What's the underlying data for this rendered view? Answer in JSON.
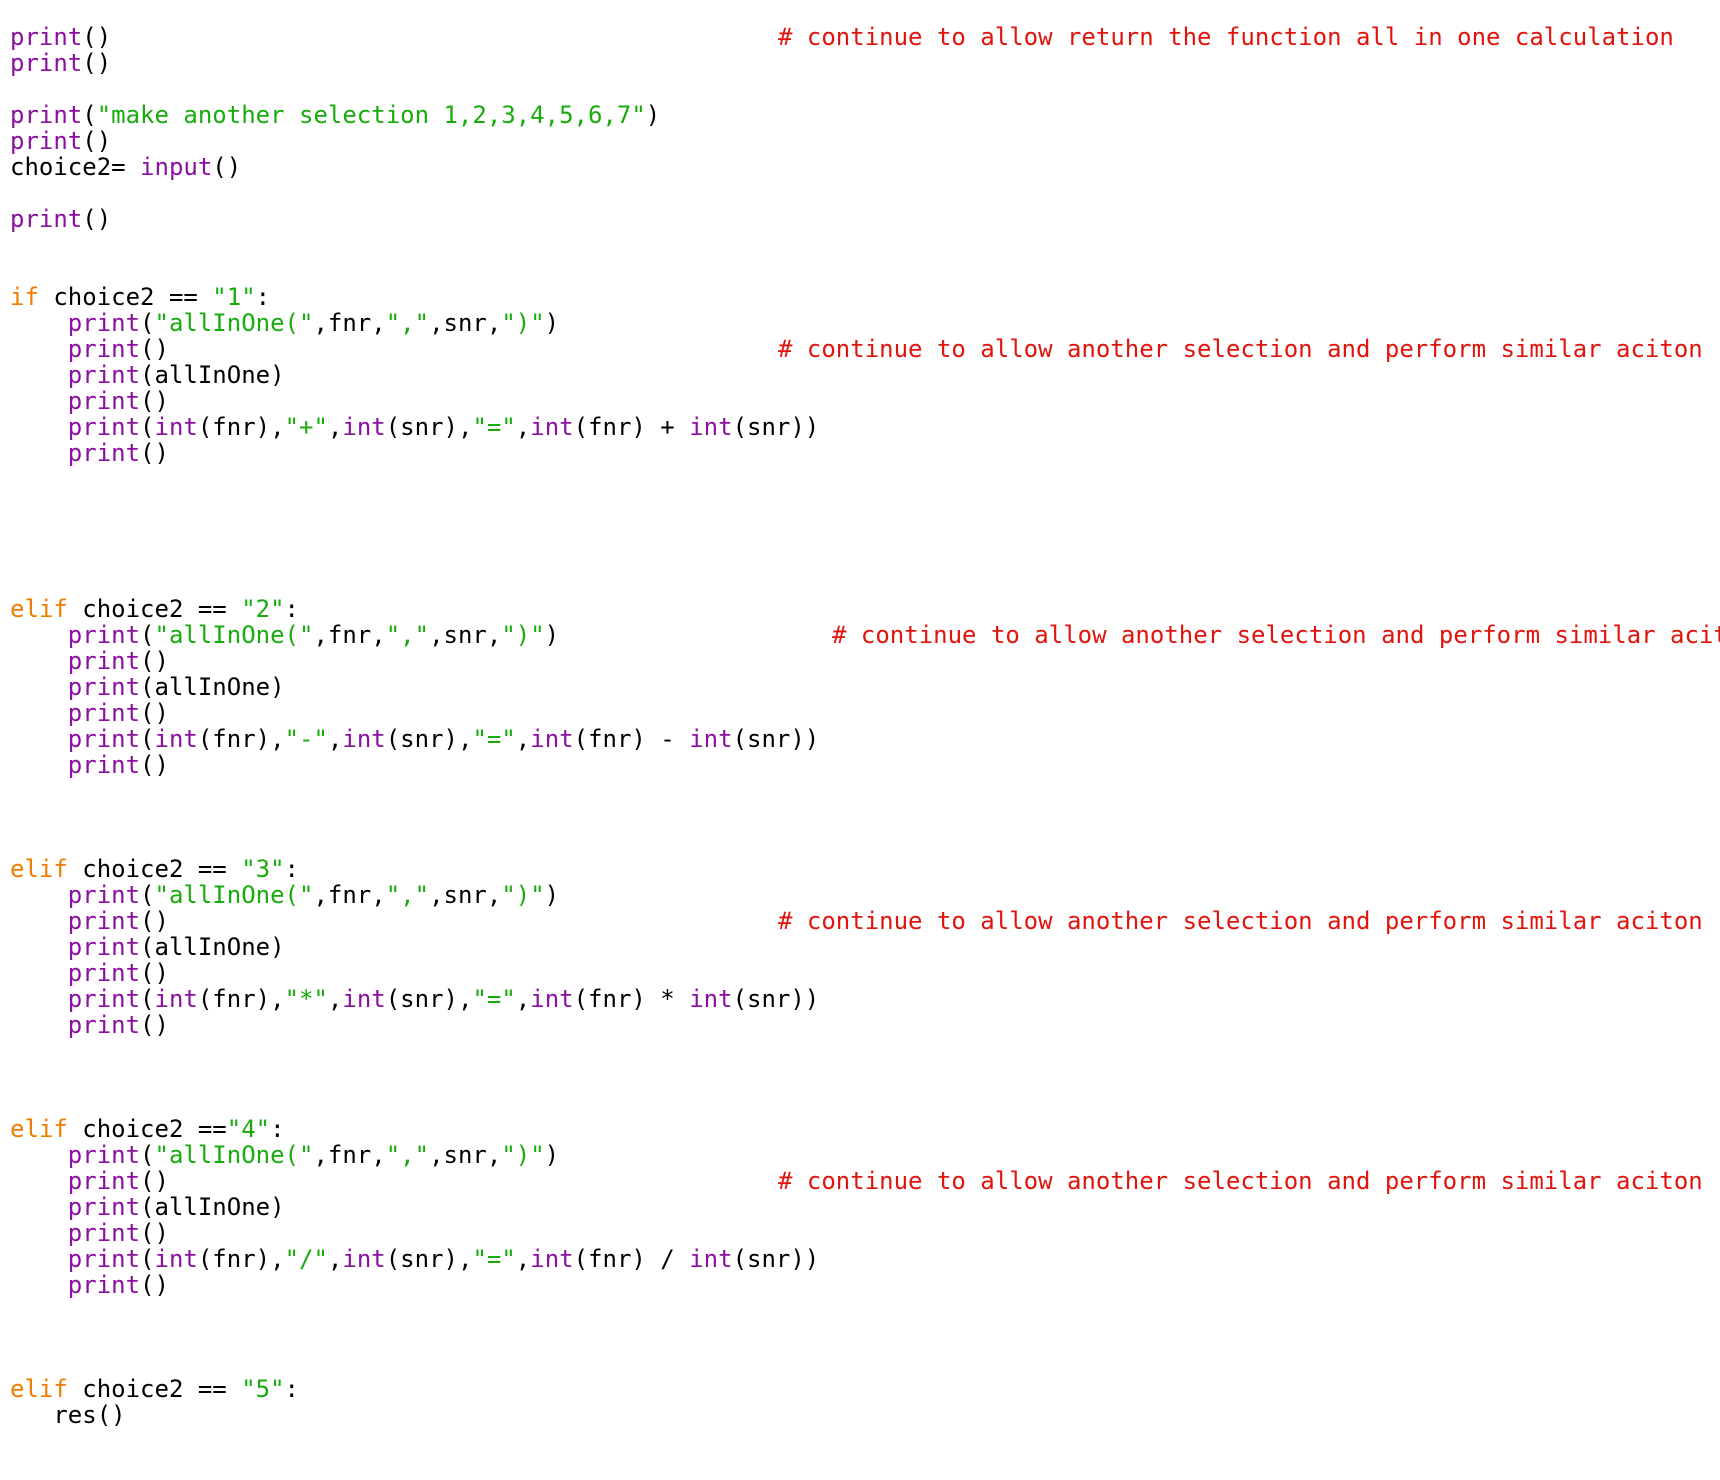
{
  "colors": {
    "function": "#8b0fa0",
    "keyword": "#f07c00",
    "string": "#18ab0c",
    "comment": "#e0140c",
    "plain": "#000000"
  },
  "lines": [
    {
      "tokens": [
        {
          "t": "fn",
          "v": "print"
        },
        {
          "t": "pl",
          "v": "()"
        }
      ],
      "comment": "# continue to allow return the function all in one calculation",
      "cpos": "c1"
    },
    {
      "tokens": [
        {
          "t": "fn",
          "v": "print"
        },
        {
          "t": "pl",
          "v": "()"
        }
      ]
    },
    {
      "tokens": []
    },
    {
      "tokens": [
        {
          "t": "fn",
          "v": "print"
        },
        {
          "t": "pl",
          "v": "("
        },
        {
          "t": "st",
          "v": "\"make another selection 1,2,3,4,5,6,7\""
        },
        {
          "t": "pl",
          "v": ")"
        }
      ]
    },
    {
      "tokens": [
        {
          "t": "fn",
          "v": "print"
        },
        {
          "t": "pl",
          "v": "()"
        }
      ]
    },
    {
      "tokens": [
        {
          "t": "pl",
          "v": "choice2= "
        },
        {
          "t": "fn",
          "v": "input"
        },
        {
          "t": "pl",
          "v": "()"
        }
      ]
    },
    {
      "tokens": []
    },
    {
      "tokens": [
        {
          "t": "fn",
          "v": "print"
        },
        {
          "t": "pl",
          "v": "()"
        }
      ]
    },
    {
      "tokens": []
    },
    {
      "tokens": []
    },
    {
      "tokens": [
        {
          "t": "kw",
          "v": "if"
        },
        {
          "t": "pl",
          "v": " choice2 == "
        },
        {
          "t": "st",
          "v": "\"1\""
        },
        {
          "t": "pl",
          "v": ":"
        }
      ]
    },
    {
      "tokens": [
        {
          "t": "pl",
          "v": "    "
        },
        {
          "t": "fn",
          "v": "print"
        },
        {
          "t": "pl",
          "v": "("
        },
        {
          "t": "st",
          "v": "\"allInOne(\""
        },
        {
          "t": "pl",
          "v": ",fnr,"
        },
        {
          "t": "st",
          "v": "\",\""
        },
        {
          "t": "pl",
          "v": ",snr,"
        },
        {
          "t": "st",
          "v": "\")\""
        },
        {
          "t": "pl",
          "v": ")"
        }
      ]
    },
    {
      "tokens": [
        {
          "t": "pl",
          "v": "    "
        },
        {
          "t": "fn",
          "v": "print"
        },
        {
          "t": "pl",
          "v": "()"
        }
      ],
      "comment": "# continue to allow another selection and perform similar aciton",
      "cpos": "c1"
    },
    {
      "tokens": [
        {
          "t": "pl",
          "v": "    "
        },
        {
          "t": "fn",
          "v": "print"
        },
        {
          "t": "pl",
          "v": "(allInOne)"
        }
      ]
    },
    {
      "tokens": [
        {
          "t": "pl",
          "v": "    "
        },
        {
          "t": "fn",
          "v": "print"
        },
        {
          "t": "pl",
          "v": "()"
        }
      ]
    },
    {
      "tokens": [
        {
          "t": "pl",
          "v": "    "
        },
        {
          "t": "fn",
          "v": "print"
        },
        {
          "t": "pl",
          "v": "("
        },
        {
          "t": "fn",
          "v": "int"
        },
        {
          "t": "pl",
          "v": "(fnr),"
        },
        {
          "t": "st",
          "v": "\"+\""
        },
        {
          "t": "pl",
          "v": ","
        },
        {
          "t": "fn",
          "v": "int"
        },
        {
          "t": "pl",
          "v": "(snr),"
        },
        {
          "t": "st",
          "v": "\"=\""
        },
        {
          "t": "pl",
          "v": ","
        },
        {
          "t": "fn",
          "v": "int"
        },
        {
          "t": "pl",
          "v": "(fnr) + "
        },
        {
          "t": "fn",
          "v": "int"
        },
        {
          "t": "pl",
          "v": "(snr))"
        }
      ]
    },
    {
      "tokens": [
        {
          "t": "pl",
          "v": "    "
        },
        {
          "t": "fn",
          "v": "print"
        },
        {
          "t": "pl",
          "v": "()"
        }
      ]
    },
    {
      "tokens": []
    },
    {
      "tokens": []
    },
    {
      "tokens": []
    },
    {
      "tokens": []
    },
    {
      "tokens": []
    },
    {
      "tokens": [
        {
          "t": "kw",
          "v": "elif"
        },
        {
          "t": "pl",
          "v": " choice2 == "
        },
        {
          "t": "st",
          "v": "\"2\""
        },
        {
          "t": "pl",
          "v": ":"
        }
      ]
    },
    {
      "tokens": [
        {
          "t": "pl",
          "v": "    "
        },
        {
          "t": "fn",
          "v": "print"
        },
        {
          "t": "pl",
          "v": "("
        },
        {
          "t": "st",
          "v": "\"allInOne(\""
        },
        {
          "t": "pl",
          "v": ",fnr,"
        },
        {
          "t": "st",
          "v": "\",\""
        },
        {
          "t": "pl",
          "v": ",snr,"
        },
        {
          "t": "st",
          "v": "\")\""
        },
        {
          "t": "pl",
          "v": ")"
        }
      ],
      "comment": "# continue to allow another selection and perform similar aciton",
      "cpos": "c2"
    },
    {
      "tokens": [
        {
          "t": "pl",
          "v": "    "
        },
        {
          "t": "fn",
          "v": "print"
        },
        {
          "t": "pl",
          "v": "()"
        }
      ]
    },
    {
      "tokens": [
        {
          "t": "pl",
          "v": "    "
        },
        {
          "t": "fn",
          "v": "print"
        },
        {
          "t": "pl",
          "v": "(allInOne)"
        }
      ]
    },
    {
      "tokens": [
        {
          "t": "pl",
          "v": "    "
        },
        {
          "t": "fn",
          "v": "print"
        },
        {
          "t": "pl",
          "v": "()"
        }
      ]
    },
    {
      "tokens": [
        {
          "t": "pl",
          "v": "    "
        },
        {
          "t": "fn",
          "v": "print"
        },
        {
          "t": "pl",
          "v": "("
        },
        {
          "t": "fn",
          "v": "int"
        },
        {
          "t": "pl",
          "v": "(fnr),"
        },
        {
          "t": "st",
          "v": "\"-\""
        },
        {
          "t": "pl",
          "v": ","
        },
        {
          "t": "fn",
          "v": "int"
        },
        {
          "t": "pl",
          "v": "(snr),"
        },
        {
          "t": "st",
          "v": "\"=\""
        },
        {
          "t": "pl",
          "v": ","
        },
        {
          "t": "fn",
          "v": "int"
        },
        {
          "t": "pl",
          "v": "(fnr) - "
        },
        {
          "t": "fn",
          "v": "int"
        },
        {
          "t": "pl",
          "v": "(snr))"
        }
      ]
    },
    {
      "tokens": [
        {
          "t": "pl",
          "v": "    "
        },
        {
          "t": "fn",
          "v": "print"
        },
        {
          "t": "pl",
          "v": "()"
        }
      ]
    },
    {
      "tokens": []
    },
    {
      "tokens": []
    },
    {
      "tokens": []
    },
    {
      "tokens": [
        {
          "t": "kw",
          "v": "elif"
        },
        {
          "t": "pl",
          "v": " choice2 == "
        },
        {
          "t": "st",
          "v": "\"3\""
        },
        {
          "t": "pl",
          "v": ":"
        }
      ]
    },
    {
      "tokens": [
        {
          "t": "pl",
          "v": "    "
        },
        {
          "t": "fn",
          "v": "print"
        },
        {
          "t": "pl",
          "v": "("
        },
        {
          "t": "st",
          "v": "\"allInOne(\""
        },
        {
          "t": "pl",
          "v": ",fnr,"
        },
        {
          "t": "st",
          "v": "\",\""
        },
        {
          "t": "pl",
          "v": ",snr,"
        },
        {
          "t": "st",
          "v": "\")\""
        },
        {
          "t": "pl",
          "v": ")"
        }
      ]
    },
    {
      "tokens": [
        {
          "t": "pl",
          "v": "    "
        },
        {
          "t": "fn",
          "v": "print"
        },
        {
          "t": "pl",
          "v": "()"
        }
      ],
      "comment": "# continue to allow another selection and perform similar aciton",
      "cpos": "c1"
    },
    {
      "tokens": [
        {
          "t": "pl",
          "v": "    "
        },
        {
          "t": "fn",
          "v": "print"
        },
        {
          "t": "pl",
          "v": "(allInOne)"
        }
      ]
    },
    {
      "tokens": [
        {
          "t": "pl",
          "v": "    "
        },
        {
          "t": "fn",
          "v": "print"
        },
        {
          "t": "pl",
          "v": "()"
        }
      ]
    },
    {
      "tokens": [
        {
          "t": "pl",
          "v": "    "
        },
        {
          "t": "fn",
          "v": "print"
        },
        {
          "t": "pl",
          "v": "("
        },
        {
          "t": "fn",
          "v": "int"
        },
        {
          "t": "pl",
          "v": "(fnr),"
        },
        {
          "t": "st",
          "v": "\"*\""
        },
        {
          "t": "pl",
          "v": ","
        },
        {
          "t": "fn",
          "v": "int"
        },
        {
          "t": "pl",
          "v": "(snr),"
        },
        {
          "t": "st",
          "v": "\"=\""
        },
        {
          "t": "pl",
          "v": ","
        },
        {
          "t": "fn",
          "v": "int"
        },
        {
          "t": "pl",
          "v": "(fnr) * "
        },
        {
          "t": "fn",
          "v": "int"
        },
        {
          "t": "pl",
          "v": "(snr))"
        }
      ]
    },
    {
      "tokens": [
        {
          "t": "pl",
          "v": "    "
        },
        {
          "t": "fn",
          "v": "print"
        },
        {
          "t": "pl",
          "v": "()"
        }
      ]
    },
    {
      "tokens": []
    },
    {
      "tokens": []
    },
    {
      "tokens": []
    },
    {
      "tokens": [
        {
          "t": "kw",
          "v": "elif"
        },
        {
          "t": "pl",
          "v": " choice2 =="
        },
        {
          "t": "st",
          "v": "\"4\""
        },
        {
          "t": "pl",
          "v": ":"
        }
      ]
    },
    {
      "tokens": [
        {
          "t": "pl",
          "v": "    "
        },
        {
          "t": "fn",
          "v": "print"
        },
        {
          "t": "pl",
          "v": "("
        },
        {
          "t": "st",
          "v": "\"allInOne(\""
        },
        {
          "t": "pl",
          "v": ",fnr,"
        },
        {
          "t": "st",
          "v": "\",\""
        },
        {
          "t": "pl",
          "v": ",snr,"
        },
        {
          "t": "st",
          "v": "\")\""
        },
        {
          "t": "pl",
          "v": ")"
        }
      ]
    },
    {
      "tokens": [
        {
          "t": "pl",
          "v": "    "
        },
        {
          "t": "fn",
          "v": "print"
        },
        {
          "t": "pl",
          "v": "()"
        }
      ],
      "comment": "# continue to allow another selection and perform similar aciton",
      "cpos": "c1"
    },
    {
      "tokens": [
        {
          "t": "pl",
          "v": "    "
        },
        {
          "t": "fn",
          "v": "print"
        },
        {
          "t": "pl",
          "v": "(allInOne)"
        }
      ]
    },
    {
      "tokens": [
        {
          "t": "pl",
          "v": "    "
        },
        {
          "t": "fn",
          "v": "print"
        },
        {
          "t": "pl",
          "v": "()"
        }
      ]
    },
    {
      "tokens": [
        {
          "t": "pl",
          "v": "    "
        },
        {
          "t": "fn",
          "v": "print"
        },
        {
          "t": "pl",
          "v": "("
        },
        {
          "t": "fn",
          "v": "int"
        },
        {
          "t": "pl",
          "v": "(fnr),"
        },
        {
          "t": "st",
          "v": "\"/\""
        },
        {
          "t": "pl",
          "v": ","
        },
        {
          "t": "fn",
          "v": "int"
        },
        {
          "t": "pl",
          "v": "(snr),"
        },
        {
          "t": "st",
          "v": "\"=\""
        },
        {
          "t": "pl",
          "v": ","
        },
        {
          "t": "fn",
          "v": "int"
        },
        {
          "t": "pl",
          "v": "(fnr) / "
        },
        {
          "t": "fn",
          "v": "int"
        },
        {
          "t": "pl",
          "v": "(snr))"
        }
      ]
    },
    {
      "tokens": [
        {
          "t": "pl",
          "v": "    "
        },
        {
          "t": "fn",
          "v": "print"
        },
        {
          "t": "pl",
          "v": "()"
        }
      ]
    },
    {
      "tokens": []
    },
    {
      "tokens": []
    },
    {
      "tokens": []
    },
    {
      "tokens": [
        {
          "t": "kw",
          "v": "elif"
        },
        {
          "t": "pl",
          "v": " choice2 == "
        },
        {
          "t": "st",
          "v": "\"5\""
        },
        {
          "t": "pl",
          "v": ":"
        }
      ]
    },
    {
      "tokens": [
        {
          "t": "pl",
          "v": "   res()"
        }
      ]
    }
  ]
}
